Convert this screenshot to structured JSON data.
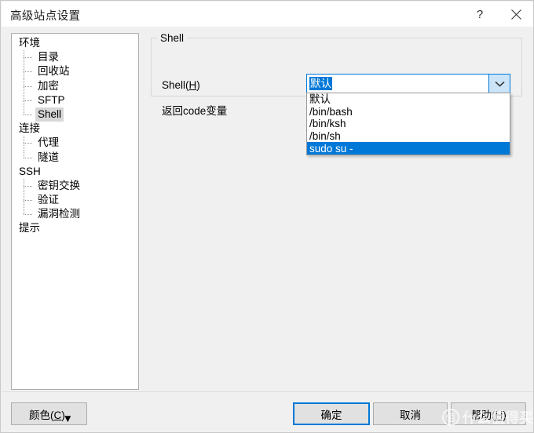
{
  "window": {
    "title": "高级站点设置",
    "help_button": "?",
    "close_button": "✕"
  },
  "sidebar": {
    "items": [
      {
        "label": "环境",
        "level": 0,
        "selected": false,
        "last": false
      },
      {
        "label": "目录",
        "level": 1,
        "selected": false,
        "last": false
      },
      {
        "label": "回收站",
        "level": 1,
        "selected": false,
        "last": false
      },
      {
        "label": "加密",
        "level": 1,
        "selected": false,
        "last": false
      },
      {
        "label": "SFTP",
        "level": 1,
        "selected": false,
        "last": false
      },
      {
        "label": "Shell",
        "level": 1,
        "selected": true,
        "last": true
      },
      {
        "label": "连接",
        "level": 0,
        "selected": false,
        "last": false
      },
      {
        "label": "代理",
        "level": 1,
        "selected": false,
        "last": false
      },
      {
        "label": "隧道",
        "level": 1,
        "selected": false,
        "last": true
      },
      {
        "label": "SSH",
        "level": 0,
        "selected": false,
        "last": false
      },
      {
        "label": "密钥交换",
        "level": 1,
        "selected": false,
        "last": false
      },
      {
        "label": "验证",
        "level": 1,
        "selected": false,
        "last": false
      },
      {
        "label": "漏洞检测",
        "level": 1,
        "selected": false,
        "last": true
      },
      {
        "label": "提示",
        "level": 0,
        "selected": false,
        "last": false
      }
    ]
  },
  "main": {
    "group_title": "Shell",
    "shell_label_prefix": "Shell(",
    "shell_label_accel": "H",
    "shell_label_suffix": ")",
    "retcode_label": "返回code变量",
    "combo": {
      "value": "默认",
      "expanded": true,
      "arrow_icon": "chevron-down-icon",
      "options": [
        {
          "label": "默认",
          "selected": false
        },
        {
          "label": "/bin/bash",
          "selected": false
        },
        {
          "label": "/bin/ksh",
          "selected": false
        },
        {
          "label": "/bin/sh",
          "selected": false
        },
        {
          "label": "sudo su -",
          "selected": true
        }
      ]
    }
  },
  "footer": {
    "color_prefix": "颜色(",
    "color_accel": "C",
    "color_suffix": ")",
    "color_arrow": "▼",
    "ok_label": "确定",
    "cancel_label": "取消",
    "help_prefix": "帮助(",
    "help_accel": "H",
    "help_suffix": ")"
  },
  "watermark": {
    "mark": "值",
    "text": "什么值得买"
  },
  "colors": {
    "accent": "#0078d7",
    "dialog_bg": "#f0f0f0",
    "titlebar_bg": "#ffffff",
    "button_bg": "#e1e1e1",
    "selection_inactive": "#d8d8d8"
  }
}
